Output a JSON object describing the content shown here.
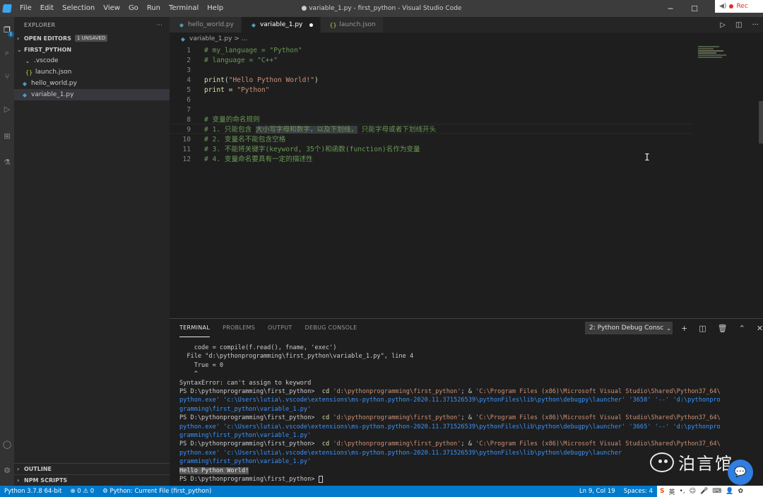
{
  "menu": [
    "File",
    "Edit",
    "Selection",
    "View",
    "Go",
    "Run",
    "Terminal",
    "Help"
  ],
  "window_title": "● variable_1.py - first_python - Visual Studio Code",
  "recorder": {
    "label": "Rec"
  },
  "sidebar": {
    "title": "EXPLORER",
    "more": "···",
    "open_editors": {
      "label": "OPEN EDITORS",
      "badge": "1 UNSAVED"
    },
    "project": {
      "label": "FIRST_PYTHON"
    },
    "tree": [
      {
        "name": ".vscode",
        "kind": "folder"
      },
      {
        "name": "launch.json",
        "kind": "json"
      },
      {
        "name": "hello_world.py",
        "kind": "py"
      },
      {
        "name": "variable_1.py",
        "kind": "py"
      }
    ],
    "outline": "OUTLINE",
    "npm_scripts": "NPM SCRIPTS"
  },
  "tabs": [
    {
      "label": "hello_world.py",
      "icon": "python-file-icon"
    },
    {
      "label": "variable_1.py",
      "icon": "python-file-icon",
      "active": true,
      "dirty": true
    },
    {
      "label": "launch.json",
      "icon": "json-file-icon"
    }
  ],
  "breadcrumb": "variable_1.py > ...",
  "editor": {
    "lines": [
      {
        "n": "1",
        "parts": [
          [
            "c-com",
            "# my_language = \"Python\""
          ]
        ]
      },
      {
        "n": "2",
        "parts": [
          [
            "c-com",
            "# language = \"C++\""
          ]
        ]
      },
      {
        "n": "3",
        "parts": []
      },
      {
        "n": "4",
        "parts": [
          [
            "c-fn",
            "print"
          ],
          [
            "c-op",
            "("
          ],
          [
            "c-str",
            "\"Hello Python World!\""
          ],
          [
            "c-op",
            ")"
          ]
        ]
      },
      {
        "n": "5",
        "parts": [
          [
            "c-fn",
            "print"
          ],
          [
            "c-op",
            " = "
          ],
          [
            "c-str",
            "\"Python\""
          ]
        ]
      },
      {
        "n": "6",
        "parts": []
      },
      {
        "n": "7",
        "parts": []
      },
      {
        "n": "8",
        "parts": [
          [
            "c-com",
            "# 变量的命名规则"
          ]
        ]
      },
      {
        "n": "9",
        "parts": [
          [
            "c-com",
            "# 1. 只能包含 "
          ],
          [
            "c-com hl",
            "大小写字母和数字，以及下划线，"
          ],
          [
            "c-com",
            " 只能字母或者下划线开头"
          ]
        ]
      },
      {
        "n": "10",
        "parts": [
          [
            "c-com",
            "# 2. 变量名不能包含空格"
          ]
        ]
      },
      {
        "n": "11",
        "parts": [
          [
            "c-com",
            "# 3. 不能将关键字(keyword, 35个)和函数(function)名作为变量"
          ]
        ]
      },
      {
        "n": "12",
        "parts": [
          [
            "c-com",
            "# 4. 变量命名要具有一定的描述性"
          ]
        ]
      }
    ]
  },
  "panel": {
    "tabs": [
      "TERMINAL",
      "PROBLEMS",
      "OUTPUT",
      "DEBUG CONSOLE"
    ],
    "terminal_select": "2: Python Debug Consc",
    "lines": [
      [
        [
          "",
          "    code = compile(f.read(), fname, 'exec')"
        ]
      ],
      [
        [
          "",
          "  File \"d:\\pythonprogramming\\first_python\\variable_1.py\", line 4"
        ]
      ],
      [
        [
          "",
          "    True = 0"
        ]
      ],
      [
        [
          "",
          "    ^"
        ]
      ],
      [
        [
          "",
          "SyntaxError: can't assign to keyword"
        ]
      ],
      [
        [
          "",
          "PS D:\\pythonprogramming\\first_python> "
        ],
        [
          "t-yellow",
          " cd "
        ],
        [
          "t-str",
          "'d:\\pythonprogramming\\first_python'"
        ],
        [
          "",
          "; & "
        ],
        [
          "t-str",
          "'C:\\Program Files (x86)\\Microsoft Visual Studio\\Shared\\Python37_64\\"
        ]
      ],
      [
        [
          "t-blue",
          "python.exe' 'c:\\Users\\lutia\\.vscode\\extensions\\ms-python.python-2020.11.371526539\\pythonFiles\\lib\\python\\debugpy\\launcher' '3658' '--' 'd:\\pythonpro"
        ]
      ],
      [
        [
          "t-blue",
          "gramming\\first_python\\variable_1.py'"
        ]
      ],
      [
        [
          "",
          "PS D:\\pythonprogramming\\first_python> "
        ],
        [
          "t-yellow",
          " cd "
        ],
        [
          "t-str",
          "'d:\\pythonprogramming\\first_python'"
        ],
        [
          "",
          "; & "
        ],
        [
          "t-str",
          "'C:\\Program Files (x86)\\Microsoft Visual Studio\\Shared\\Python37_64\\"
        ]
      ],
      [
        [
          "t-blue",
          "python.exe' 'c:\\Users\\lutia\\.vscode\\extensions\\ms-python.python-2020.11.371526539\\pythonFiles\\lib\\python\\debugpy\\launcher' '3665' '--' 'd:\\pythonpro"
        ]
      ],
      [
        [
          "t-blue",
          "gramming\\first_python\\variable_1.py'"
        ]
      ],
      [
        [
          "",
          "PS D:\\pythonprogramming\\first_python> "
        ],
        [
          "t-yellow",
          " cd "
        ],
        [
          "t-str",
          "'d:\\pythonprogramming\\first_python'"
        ],
        [
          "",
          "; & "
        ],
        [
          "t-str",
          "'C:\\Program Files (x86)\\Microsoft Visual Studio\\Shared\\Python37_64\\"
        ]
      ],
      [
        [
          "t-blue",
          "python.exe' 'c:\\Users\\lutia\\.vscode\\extensions\\ms-python.python-2020.11.371526539\\pythonFiles\\lib\\python\\debugpy\\launcher"
        ]
      ],
      [
        [
          "t-blue",
          "gramming\\first_python\\variable_1.py'"
        ]
      ],
      [
        [
          "t-hl",
          "Hello Python World!"
        ]
      ],
      [
        [
          "",
          "PS D:\\pythonprogramming\\first_python> "
        ],
        [
          "cursor",
          ""
        ]
      ]
    ]
  },
  "watermark": "泊言馆",
  "statusbar": {
    "python": "Python 3.7.8 64-bit",
    "problems": "⊗ 0 ⚠ 0",
    "run_config": "Python: Current File (first_python)",
    "position": "Ln 9, Col 19",
    "spaces": "Spaces: 4",
    "ime_label": "英"
  },
  "colors": {
    "statusbar": "#007acc",
    "activitybar": "#333333",
    "sidebar": "#252526",
    "editor": "#1e1e1e",
    "comment": "#6a9955",
    "string": "#ce9178",
    "function": "#dcdcaa"
  }
}
